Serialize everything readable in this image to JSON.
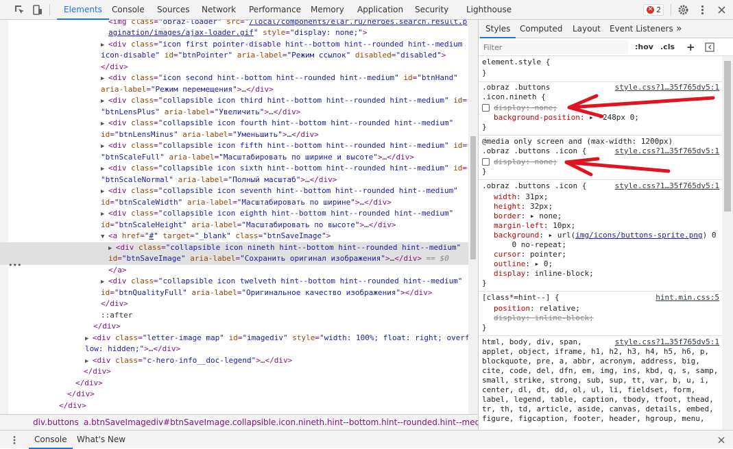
{
  "toolbar": {
    "tabs": [
      "Elements",
      "Console",
      "Sources",
      "Network",
      "Performance",
      "Memory",
      "Application",
      "Security",
      "Lighthouse"
    ],
    "active_tab": "Elements",
    "error_count": "2",
    "accent": "#1a73e8"
  },
  "dom": {
    "lines": [
      {
        "indent": 0,
        "html": "<img class=\"obraz-loader\" src=\"/local/components/elar.ru/heroes.search.result.p"
      },
      {
        "indent": 0,
        "html": "agination/images/ajax-loader.gif\" style=\"display: none;\">"
      },
      {
        "text": "<div class=\"icon first pointer-disable hint--bottom hint--rounded hint--medium"
      },
      {
        "text": "icon-disable\" id=\"btnPointer\" aria-label=\"Режим ссылок\" disabled=\"disabled\">"
      },
      {
        "text": "</div>"
      },
      {
        "text": "<div class=\"icon second hint--bottom hint--rounded hint--medium\" id=\"btnHand\""
      },
      {
        "text": "aria-label=\"Режим перемещения\">…</div>"
      },
      {
        "text": "<div class=\"collapsible icon third hint--bottom hint--rounded hint--medium\" id="
      },
      {
        "text": "\"btnLensPlus\" aria-label=\"Увеличить\">…</div>"
      },
      {
        "text": "<div class=\"collapsible icon fourth hint--bottom hint--rounded hint--medium\""
      },
      {
        "text": "id=\"btnLensMinus\" aria-label=\"Уменьшить\">…</div>"
      },
      {
        "text": "<div class=\"collapsible icon fifth hint--bottom hint--rounded hint--medium\" id="
      },
      {
        "text": "\"btnScaleFull\" aria-label=\"Масштабировать по ширине и высоте\">…</div>"
      },
      {
        "text": "<div class=\"collapsible icon sixth hint--bottom hint--rounded hint--medium\" id="
      },
      {
        "text": "\"btnScaleNormal\" aria-label=\"Полный масштаб\">…</div>"
      },
      {
        "text": "<div class=\"collapsible icon seventh hint--bottom hint--rounded hint--medium\""
      },
      {
        "text": "id=\"btnScaleWidth\" aria-label=\"Масштабировать по ширине\">…</div>"
      },
      {
        "text": "<div class=\"collapsible icon eighth hint--bottom hint--rounded hint--medium\""
      },
      {
        "text": "id=\"btnScaleHeight\" aria-label=\"Масштабировать по высоте\">…</div>"
      },
      {
        "text": "<a href=\"#\" target=\"_blank\" class=\"btnSaveImage\">"
      },
      {
        "text": "<div class=\"collapsible icon nineth hint--bottom hint--rounded hint--medium\""
      },
      {
        "text": "id=\"btnSaveImage\" aria-label=\"Сохранить оригинал изображения\">…</div> == $0"
      },
      {
        "text": "</a>"
      },
      {
        "text": "<div class=\"collapsible icon twelveth hint--bottom hint--rounded hint--medium\""
      },
      {
        "text": "id=\"btnQualityFull\" aria-label=\"Оригинальное качество изображения\"></div>"
      },
      {
        "text": "</div>"
      },
      {
        "text": "::after"
      },
      {
        "text": "</div>"
      },
      {
        "text": "<div class=\"letter-image map\" id=\"imagediv\" style=\"width: 100%; float: right; overf"
      },
      {
        "text": "low: hidden;\">…</div>"
      },
      {
        "text": "<div class=\"c-hero-info__doc-legend\">…</div>"
      },
      {
        "text": "</div>"
      },
      {
        "text": "</div>"
      },
      {
        "text": "</div>"
      },
      {
        "text": "</div>"
      }
    ]
  },
  "breadcrumb": [
    "div.buttons",
    "a.btnSaveImage",
    "div#btnSaveImage.collapsible.icon.nineth.hint--bottom.hint--rounded.hint--medium"
  ],
  "styles_tabs": [
    "Styles",
    "Computed",
    "Layout",
    "Event Listeners"
  ],
  "styles_more": "»",
  "filter": {
    "placeholder": "Filter",
    "hov": ":hov",
    "cls": ".cls",
    "plus": "+"
  },
  "rules": {
    "element_style": {
      "selector": "element.style {",
      "close": "}"
    },
    "r1": {
      "selector1": ".obraz .buttons",
      "selector2": ".icon.nineth {",
      "source": "style.css?1…35f765dv5:1",
      "p1": "display: none;",
      "p2n": "background-position:",
      "p2v": " ▸ -248px 0;",
      "close": "}"
    },
    "r2": {
      "media": "@media only screen and (max-width: 1200px)",
      "selector": ".obraz .buttons .icon {",
      "source": "style.css?1…35f765dv5:1",
      "p1": "display: none;",
      "close": "}"
    },
    "r3": {
      "selector": ".obraz .buttons .icon {",
      "source": "style.css?1…35f765dv5:1",
      "props": [
        {
          "n": "width",
          "v": "31px;"
        },
        {
          "n": "height",
          "v": "32px;"
        },
        {
          "n": "border",
          "v": "▸ none;"
        },
        {
          "n": "margin-left",
          "v": "10px;"
        },
        {
          "n": "background",
          "v": "▸ url(",
          "link": "img/icons/buttons-sprite.png",
          "v2": ") 0"
        },
        {
          "n": "",
          "v": "    0 no-repeat;"
        },
        {
          "n": "cursor",
          "v": "pointer;"
        },
        {
          "n": "outline",
          "v": "▸ 0;"
        },
        {
          "n": "display",
          "v": "inline-block;"
        }
      ],
      "close": "}"
    },
    "r4": {
      "selector": "[class*=hint--] {",
      "source": "hint.min.css:5",
      "p1n": "position",
      "p1v": "relative;",
      "p2": "display: inline-block;",
      "close": "}"
    },
    "r5": {
      "source": "style.css?1…35f765dv5:1",
      "lines": [
        "html, body, div, span,",
        "applet, object, iframe, h1, h2, h3, h4, h5, h6, p,",
        "blockquote, pre, a, abbr, acronym, address, big,",
        "cite, code, del, dfn, em, img, ins, kbd, q, s, samp,",
        "small, strike, strong, sub, sup, tt, var, b, u, i,",
        "center, dl, dt, dd, ol, ul, li, fieldset, form,",
        "label, legend, table, caption, tbody, tfoot, thead,",
        "tr, th, td, article, aside, canvas, details, embed,",
        "figure, figcaption, footer, header, hgroup, menu,"
      ]
    }
  },
  "drawer": {
    "tabs": [
      "Console",
      "What's New"
    ],
    "active": "Console"
  },
  "arrow_color": "#e0141e"
}
